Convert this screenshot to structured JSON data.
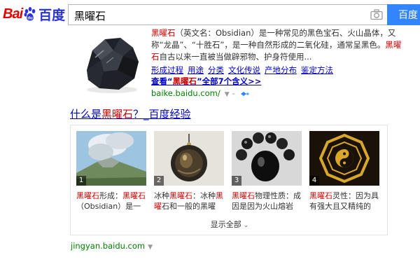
{
  "header": {
    "logo_bai": "Bai",
    "logo_du": "du",
    "logo_cn": "百度",
    "query": "黑曜石",
    "search_button": "百度"
  },
  "baike": {
    "line1_hl": "黑曜石",
    "line1_rest": "（英文名：Obsidian）是一种常见的黑色宝石、火山晶体，又",
    "line2_a": "称“龙晶”、“十胜石”，是一种自然形成的二氧化硅，通常呈黑色。",
    "line2_hl": "黑曜",
    "line3_hl": "石",
    "line3_rest": "自古以来一直被当做辟邪物、护身符使用...",
    "sublinks": [
      "形成过程",
      "用途",
      "分类",
      "文化传说",
      "产地分布",
      "鉴定方法"
    ],
    "more_prefix": "查看“",
    "more_hl": "黑曜石",
    "more_suffix": "”全部7个含义>>",
    "url": "baike.baidu.com/",
    "url_caret": "▼",
    "url_dash": "-"
  },
  "jingyan": {
    "title_prefix": "什么是",
    "title_hl": "黑曜石",
    "title_suffix": "？_百度经验",
    "cards": [
      {
        "num": "1",
        "cap_hl": "黑曜石",
        "cap_mid": "形成：",
        "cap_hl2": "黑曜石",
        "cap_rest": "（Obsidian）是一种..."
      },
      {
        "num": "2",
        "cap_a": "冰种",
        "cap_hl": "黑曜石",
        "cap_mid": "：冰种",
        "cap_hl2": "黑曜",
        "cap_rest": "石和一般的黑曜石..."
      },
      {
        "num": "3",
        "cap_hl": "黑曜石",
        "cap_mid": "物理性质：成因",
        "cap_rest": "是因为火山熔岩迅..."
      },
      {
        "num": "4",
        "cap_hl": "黑曜石",
        "cap_mid": "灵性：因为具有",
        "cap_rest": "强大且又精纯的能..."
      }
    ],
    "show_all": "显示全部",
    "show_all_chevron": "⌄",
    "url": "jingyan.baidu.com",
    "url_caret": "▼"
  }
}
